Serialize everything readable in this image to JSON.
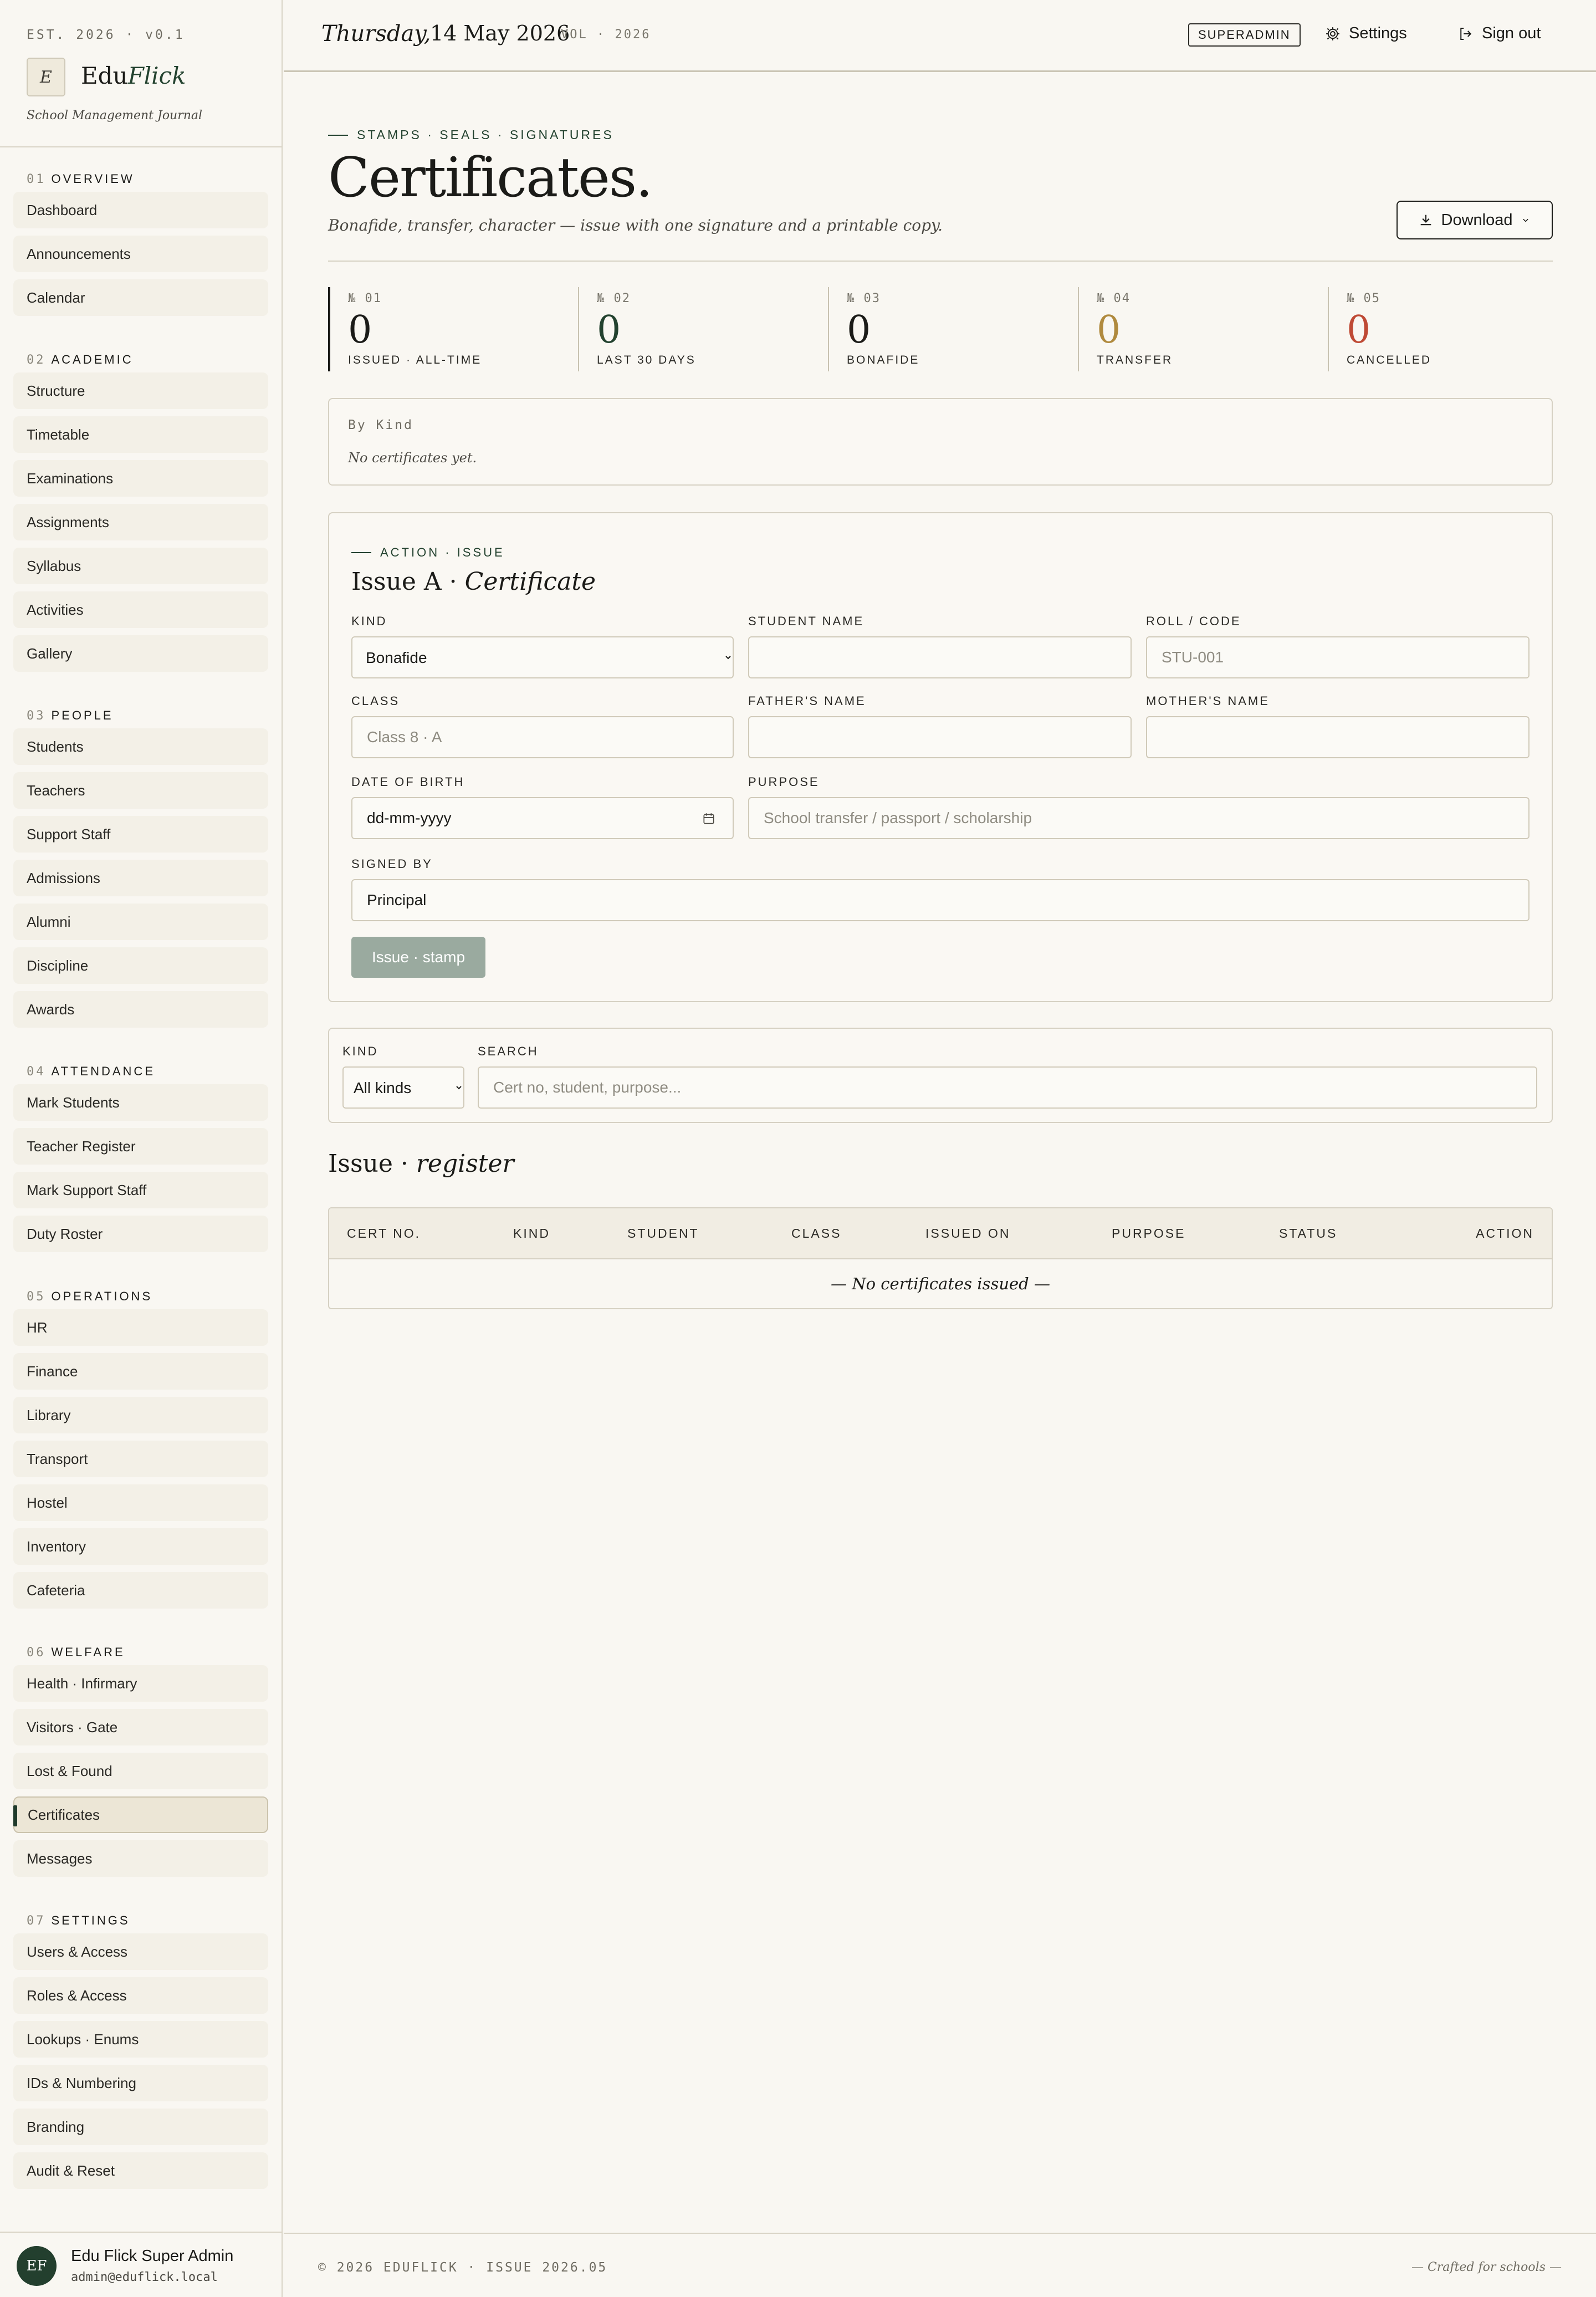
{
  "brand": {
    "est": "EST. 2026 · v0.1",
    "logo_letter": "E",
    "name_a": "Edu",
    "name_b": "Flick",
    "tagline": "School Management Journal"
  },
  "sidebar": {
    "sections": [
      {
        "num": "01",
        "title": "OVERVIEW",
        "items": [
          "Dashboard",
          "Announcements",
          "Calendar"
        ]
      },
      {
        "num": "02",
        "title": "ACADEMIC",
        "items": [
          "Structure",
          "Timetable",
          "Examinations",
          "Assignments",
          "Syllabus",
          "Activities",
          "Gallery"
        ]
      },
      {
        "num": "03",
        "title": "PEOPLE",
        "items": [
          "Students",
          "Teachers",
          "Support Staff",
          "Admissions",
          "Alumni",
          "Discipline",
          "Awards"
        ]
      },
      {
        "num": "04",
        "title": "ATTENDANCE",
        "items": [
          "Mark Students",
          "Teacher Register",
          "Mark Support Staff",
          "Duty Roster"
        ]
      },
      {
        "num": "05",
        "title": "OPERATIONS",
        "items": [
          "HR",
          "Finance",
          "Library",
          "Transport",
          "Hostel",
          "Inventory",
          "Cafeteria"
        ]
      },
      {
        "num": "06",
        "title": "WELFARE",
        "items": [
          "Health · Infirmary",
          "Visitors · Gate",
          "Lost & Found",
          "Certificates",
          "Messages"
        ]
      },
      {
        "num": "07",
        "title": "SETTINGS",
        "items": [
          "Users & Access",
          "Roles & Access",
          "Lookups · Enums",
          "IDs & Numbering",
          "Branding",
          "Audit & Reset"
        ]
      }
    ],
    "active": "Certificates"
  },
  "user": {
    "initials": "EF",
    "name": "Edu Flick Super Admin",
    "email": "admin@eduflick.local"
  },
  "header": {
    "day": "Thursday,",
    "date": "14 May 2026",
    "vol": "VOL · 2026",
    "role": "SUPERADMIN",
    "settings": "Settings",
    "signout": "Sign out"
  },
  "page": {
    "kicker": "STAMPS · SEALS · SIGNATURES",
    "title": "Certificates.",
    "subtitle": "Bonafide, transfer, character — issue with one signature and a printable copy.",
    "download": "Download"
  },
  "stats": [
    {
      "num": "№ 01",
      "value": "0",
      "label": "ISSUED · ALL-TIME",
      "color": "#1b1b18"
    },
    {
      "num": "№ 02",
      "value": "0",
      "label": "LAST 30 DAYS",
      "color": "#23422f"
    },
    {
      "num": "№ 03",
      "value": "0",
      "label": "BONAFIDE",
      "color": "#1b1b18"
    },
    {
      "num": "№ 04",
      "value": "0",
      "label": "TRANSFER",
      "color": "#b08a3e"
    },
    {
      "num": "№ 05",
      "value": "0",
      "label": "CANCELLED",
      "color": "#bf4a35"
    }
  ],
  "by_kind": {
    "title": "By Kind",
    "empty": "No certificates yet."
  },
  "issue_form": {
    "kicker": "ACTION · ISSUE",
    "title_a": "Issue A ·",
    "title_b": "Certificate",
    "kind_label": "KIND",
    "kind_value": "Bonafide",
    "student_label": "STUDENT NAME",
    "student_value": "",
    "roll_label": "ROLL / CODE",
    "roll_placeholder": "STU-001",
    "class_label": "CLASS",
    "class_placeholder": "Class 8 · A",
    "father_label": "FATHER'S NAME",
    "father_value": "",
    "mother_label": "MOTHER'S NAME",
    "mother_value": "",
    "dob_label": "DATE OF BIRTH",
    "dob_value": "dd-mm-yyyy",
    "purpose_label": "PURPOSE",
    "purpose_placeholder": "School transfer / passport / scholarship",
    "signed_label": "SIGNED BY",
    "signed_value": "Principal",
    "submit": "Issue · stamp"
  },
  "filter": {
    "kind_label": "KIND",
    "kind_value": "All kinds",
    "search_label": "SEARCH",
    "search_placeholder": "Cert no, student, purpose..."
  },
  "register": {
    "title_a": "Issue ·",
    "title_b": "register",
    "columns": [
      "CERT NO.",
      "KIND",
      "STUDENT",
      "CLASS",
      "ISSUED ON",
      "PURPOSE",
      "STATUS",
      "ACTION"
    ],
    "empty": "— No certificates issued —"
  },
  "footer": {
    "left": "© 2026 EDUFLICK · ISSUE 2026.05",
    "right": "— Crafted for schools —"
  }
}
